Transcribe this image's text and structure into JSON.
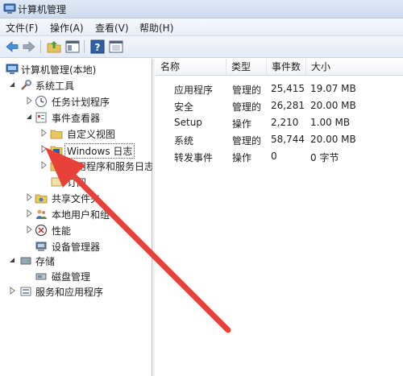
{
  "window": {
    "title": "计算机管理"
  },
  "menu": [
    "文件(F)",
    "操作(A)",
    "查看(V)",
    "帮助(H)"
  ],
  "toolbar": {
    "icons": [
      "back-arrow-icon",
      "forward-arrow-icon",
      "up-folder-icon",
      "show-hide-tree-icon",
      "help-icon",
      "properties-icon"
    ]
  },
  "tree": {
    "root": "计算机管理(本地)",
    "system_tools": "系统工具",
    "task_scheduler": "任务计划程序",
    "event_viewer": "事件查看器",
    "custom_views": "自定义视图",
    "windows_logs": "Windows 日志",
    "app_service_logs": "应用程序和服务日志",
    "subscriptions": "订阅",
    "shared_folders": "共享文件夹",
    "local_users": "本地用户和组",
    "performance": "性能",
    "device_manager": "设备管理器",
    "storage": "存储",
    "disk_management": "磁盘管理",
    "services_apps": "服务和应用程序"
  },
  "list": {
    "columns": [
      "名称",
      "类型",
      "事件数",
      "大小"
    ],
    "rows": [
      {
        "name": "应用程序",
        "type": "管理的",
        "count": "25,415",
        "size": "19.07 MB"
      },
      {
        "name": "安全",
        "type": "管理的",
        "count": "26,281",
        "size": "20.00 MB"
      },
      {
        "name": "Setup",
        "type": "操作",
        "count": "2,210",
        "size": "1.00 MB"
      },
      {
        "name": "系统",
        "type": "管理的",
        "count": "58,744",
        "size": "20.00 MB"
      },
      {
        "name": "转发事件",
        "type": "操作",
        "count": "0",
        "size": "0 字节"
      }
    ]
  },
  "colors": {
    "annotation_arrow": "#e8413a",
    "selection_border": "#555555"
  }
}
